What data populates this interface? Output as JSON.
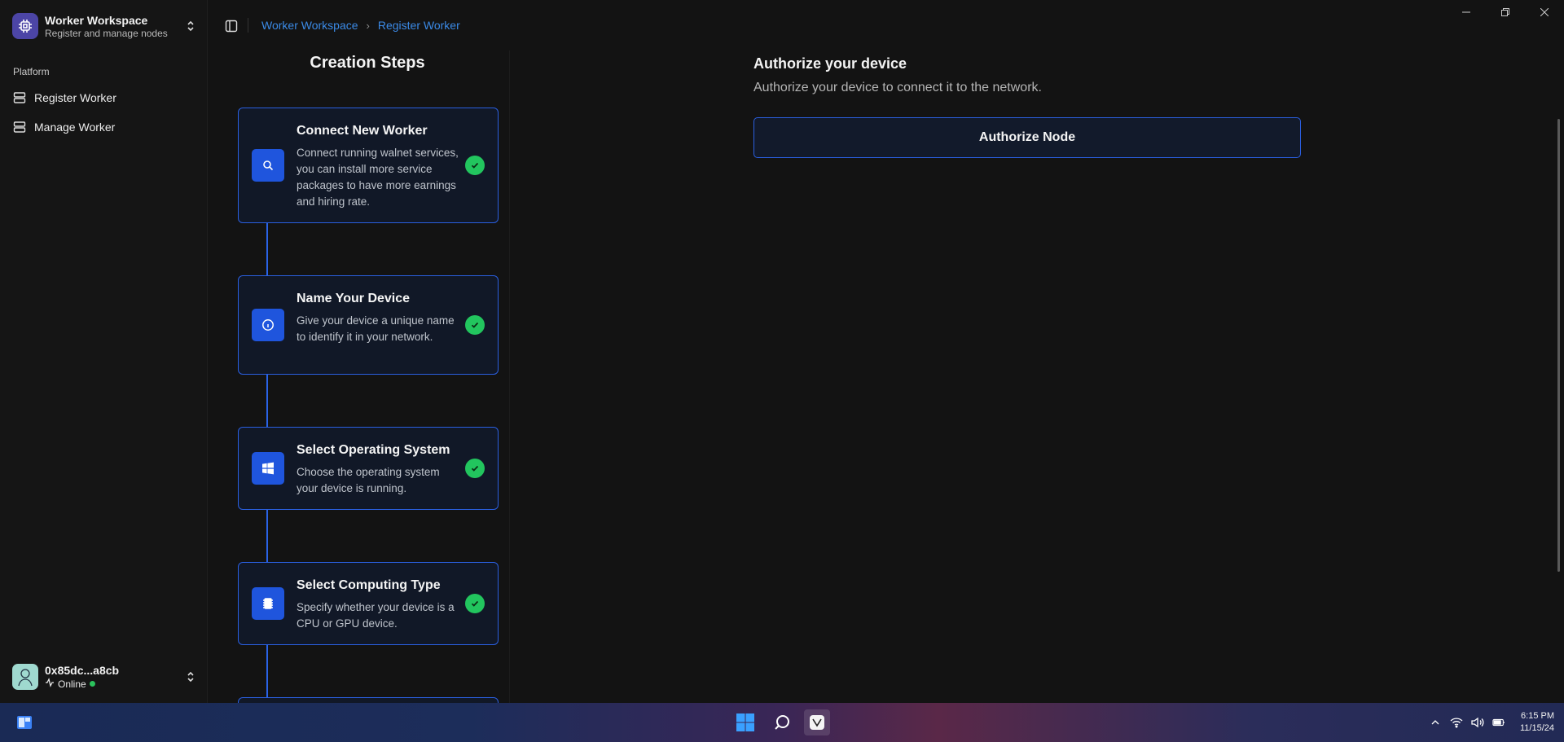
{
  "workspace": {
    "title": "Worker Workspace",
    "subtitle": "Register and manage nodes"
  },
  "sidebar": {
    "section_label": "Platform",
    "items": [
      {
        "label": "Register Worker",
        "icon": "server-icon"
      },
      {
        "label": "Manage Worker",
        "icon": "server-icon"
      }
    ]
  },
  "user": {
    "address": "0x85dc...a8cb",
    "status": "Online",
    "status_color": "#2bc25c"
  },
  "breadcrumb": {
    "root": "Worker Workspace",
    "current": "Register Worker"
  },
  "steps": {
    "title": "Creation Steps",
    "items": [
      {
        "title": "Connect New Worker",
        "desc": "Connect running walnet services, you can install more service packages to have more earnings and hiring rate.",
        "icon": "search-icon",
        "done": true
      },
      {
        "title": "Name Your Device",
        "desc": "Give your device a unique name to identify it in your network.",
        "icon": "info-icon",
        "done": true
      },
      {
        "title": "Select Operating System",
        "desc": "Choose the operating system your device is running.",
        "icon": "windows-icon",
        "done": true
      },
      {
        "title": "Select Computing Type",
        "desc": "Specify whether your device is a CPU or GPU device.",
        "icon": "chip-icon",
        "done": true
      }
    ]
  },
  "main": {
    "title": "Authorize your device",
    "subtitle": "Authorize your device to connect it to the network.",
    "button_label": "Authorize Node"
  },
  "taskbar": {
    "time": "6:15 PM",
    "date": "11/15/24"
  },
  "colors": {
    "accent": "#2a5fe0",
    "success": "#22c55e",
    "link": "#3b8ae6"
  }
}
